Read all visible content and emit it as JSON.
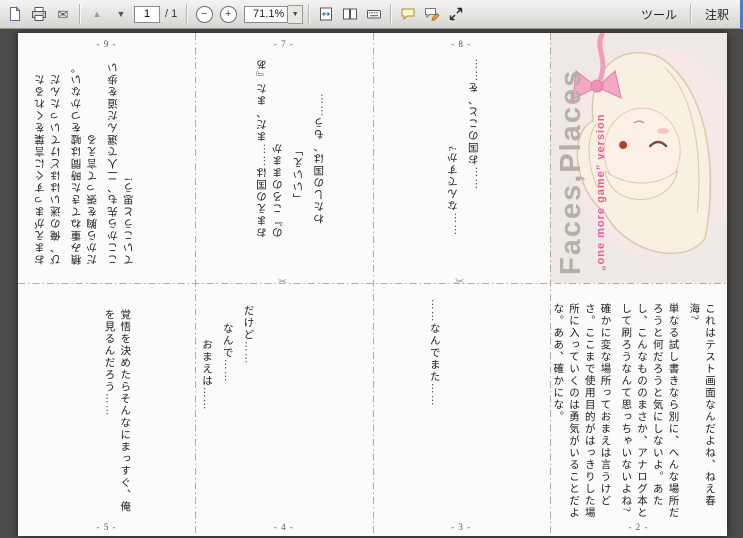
{
  "toolbar": {
    "page_current": "1",
    "page_total": "/ 1",
    "zoom_level": "71.1%",
    "tools_label": "ツール",
    "comment_label": "注釈",
    "icons": {
      "page_up": "▲",
      "page_down": "▼",
      "zoom_out": "−",
      "zoom_in": "+",
      "zoom_dropdown": "▼",
      "email": "✉",
      "scissors": "✂"
    }
  },
  "colors": {
    "accent_pink": "#f2579e",
    "cover_title_gray": "#b5afa8",
    "canvas_bg": "#4b4a48",
    "toolbar_edge_blue": "#4a7ebb"
  },
  "sheet": {
    "pages": {
      "p9": {
        "number": "- 9 -",
        "cols": [
          "おまえがまっすぐに言葉をくれるたび、俺の迷いはほどけていったんだ",
          "積み重ねてきた時間は嘘をつかない。だから胸を張って言える",
          "ここから先も、二人で選んだ道を歩いていこうと思う!"
        ]
      },
      "p7": {
        "number": "- 7 -",
        "cols": [
          "おまえの国は……まだ、また『あの』ころのままか",
          "「いいえ」",
          "わたしの国は、もう……"
        ]
      },
      "p8": {
        "number": "- 8 -",
        "cols": [
          "……なんですか?",
          "……お国のこと、を……"
        ]
      },
      "cover": {
        "title": "Faces,Places",
        "subtitle": "„one more game” version"
      },
      "p5": {
        "number": "- 5 -",
        "cols": [
          "覚悟を決めたらそんなにまっすぐ、俺を見るんだろう……"
        ]
      },
      "p4": {
        "number": "- 4 -",
        "cols": [
          "だけど……",
          "なんで……",
          "おまえは……"
        ]
      },
      "p3": {
        "number": "- 3 -",
        "cols": [
          "……なんでまた……"
        ]
      },
      "p2": {
        "number": "- 2 -",
        "cols": [
          "これはテスト画面なんだよね、ねえ春海?",
          "単なる試し書きなら別に、へんな場所だろうと何だろうと気にしないよ。あたし、こんなもののまさか、アナログ本として刷ろうなんて思っちゃいないよね?",
          "確かに変な場所っておまえは言うけどさ。ここまで使用目的がはっきりした場所に入っていくのは勇気がいることだよな。ああ、確かにな。"
        ]
      }
    }
  }
}
